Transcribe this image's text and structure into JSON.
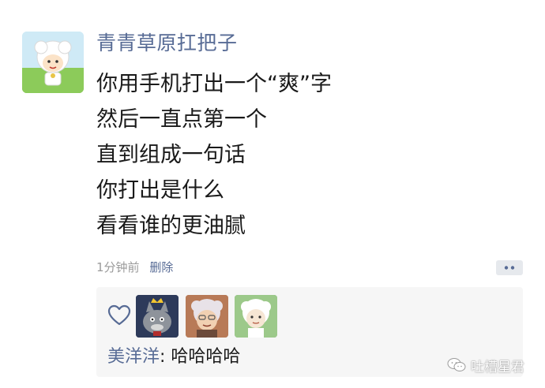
{
  "post": {
    "username": "青青草原扛把子",
    "lines": [
      "你用手机打出一个“爽”字",
      "然后一直点第一个",
      "直到组成一句话",
      "你打出是什么",
      "看看谁的更油腻"
    ],
    "timestamp": "1分钟前",
    "delete_label": "删除"
  },
  "avatar_icon": "sheep-avatar-icon",
  "interactions": {
    "like_icon": "heart-outline-icon",
    "likers": [
      {
        "icon": "grey-wolf-avatar-icon"
      },
      {
        "icon": "old-sheep-avatar-icon"
      },
      {
        "icon": "sheep-avatar-icon"
      }
    ],
    "comment": {
      "commenter": "美洋洋",
      "separator": ": ",
      "text": "哈哈哈哈"
    }
  },
  "watermark": {
    "text": "吐槽星君",
    "icon": "wechat-logo-icon"
  },
  "colors": {
    "link": "#576b95",
    "text": "#1a1a1a",
    "meta": "#9a9a9a",
    "box_bg": "#f6f6f6"
  }
}
